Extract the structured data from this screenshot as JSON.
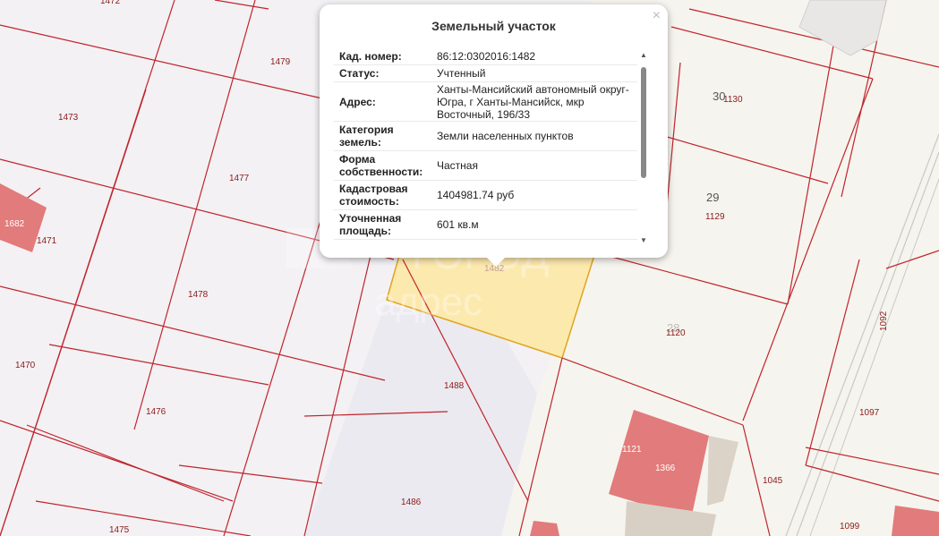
{
  "map": {
    "parcels": [
      {
        "id": "p1472",
        "label": "1472"
      },
      {
        "id": "p1479",
        "label": "1479"
      },
      {
        "id": "p1473",
        "label": "1473"
      },
      {
        "id": "p1477",
        "label": "1477"
      },
      {
        "id": "p1471",
        "label": "1471"
      },
      {
        "id": "p1478",
        "label": "1478"
      },
      {
        "id": "p1470",
        "label": "1470"
      },
      {
        "id": "p1476",
        "label": "1476"
      },
      {
        "id": "p1475",
        "label": "1475"
      },
      {
        "id": "p1488",
        "label": "1488"
      },
      {
        "id": "p1486",
        "label": "1486"
      },
      {
        "id": "p1482",
        "label": "1482"
      },
      {
        "id": "p1130",
        "label": "1130"
      },
      {
        "id": "p1129",
        "label": "1129"
      },
      {
        "id": "p1120",
        "label": "1120"
      },
      {
        "id": "p1092",
        "label": "1092"
      },
      {
        "id": "p1097",
        "label": "1097"
      },
      {
        "id": "p1045",
        "label": "1045"
      },
      {
        "id": "p1099",
        "label": "1099"
      }
    ],
    "buildings": [
      {
        "id": "b1682",
        "label": "1682"
      },
      {
        "id": "b1121",
        "label": "1121"
      },
      {
        "id": "b1366",
        "label": "1366"
      }
    ],
    "house_numbers": [
      "30",
      "29",
      "28"
    ],
    "watermark": {
      "logo_text": "ГОРОД",
      "sub_text": "адрес"
    }
  },
  "popup": {
    "title": "Земельный участок",
    "close_label": "×",
    "rows": [
      {
        "key": [
          "Кад. номер:"
        ],
        "value": [
          "86:12:0302016:1482"
        ]
      },
      {
        "key": [
          "Статус:"
        ],
        "value": [
          "Учтенный"
        ]
      },
      {
        "key": [
          "Адрес:"
        ],
        "value": [
          "Ханты-Мансийский автономный округ-",
          "Югра, г Ханты-Мансийск, мкр",
          "Восточный, 196/33"
        ]
      },
      {
        "key": [
          "Категория",
          "земель:"
        ],
        "value": [
          "Земли населенных пунктов"
        ]
      },
      {
        "key": [
          "Форма",
          "собственности:"
        ],
        "value": [
          "Частная"
        ]
      },
      {
        "key": [
          "Кадастровая",
          "стоимость:"
        ],
        "value": [
          "1404981.74 руб"
        ]
      },
      {
        "key": [
          "Уточненная",
          "площадь:"
        ],
        "value": [
          "601 кв.м"
        ]
      }
    ]
  }
}
